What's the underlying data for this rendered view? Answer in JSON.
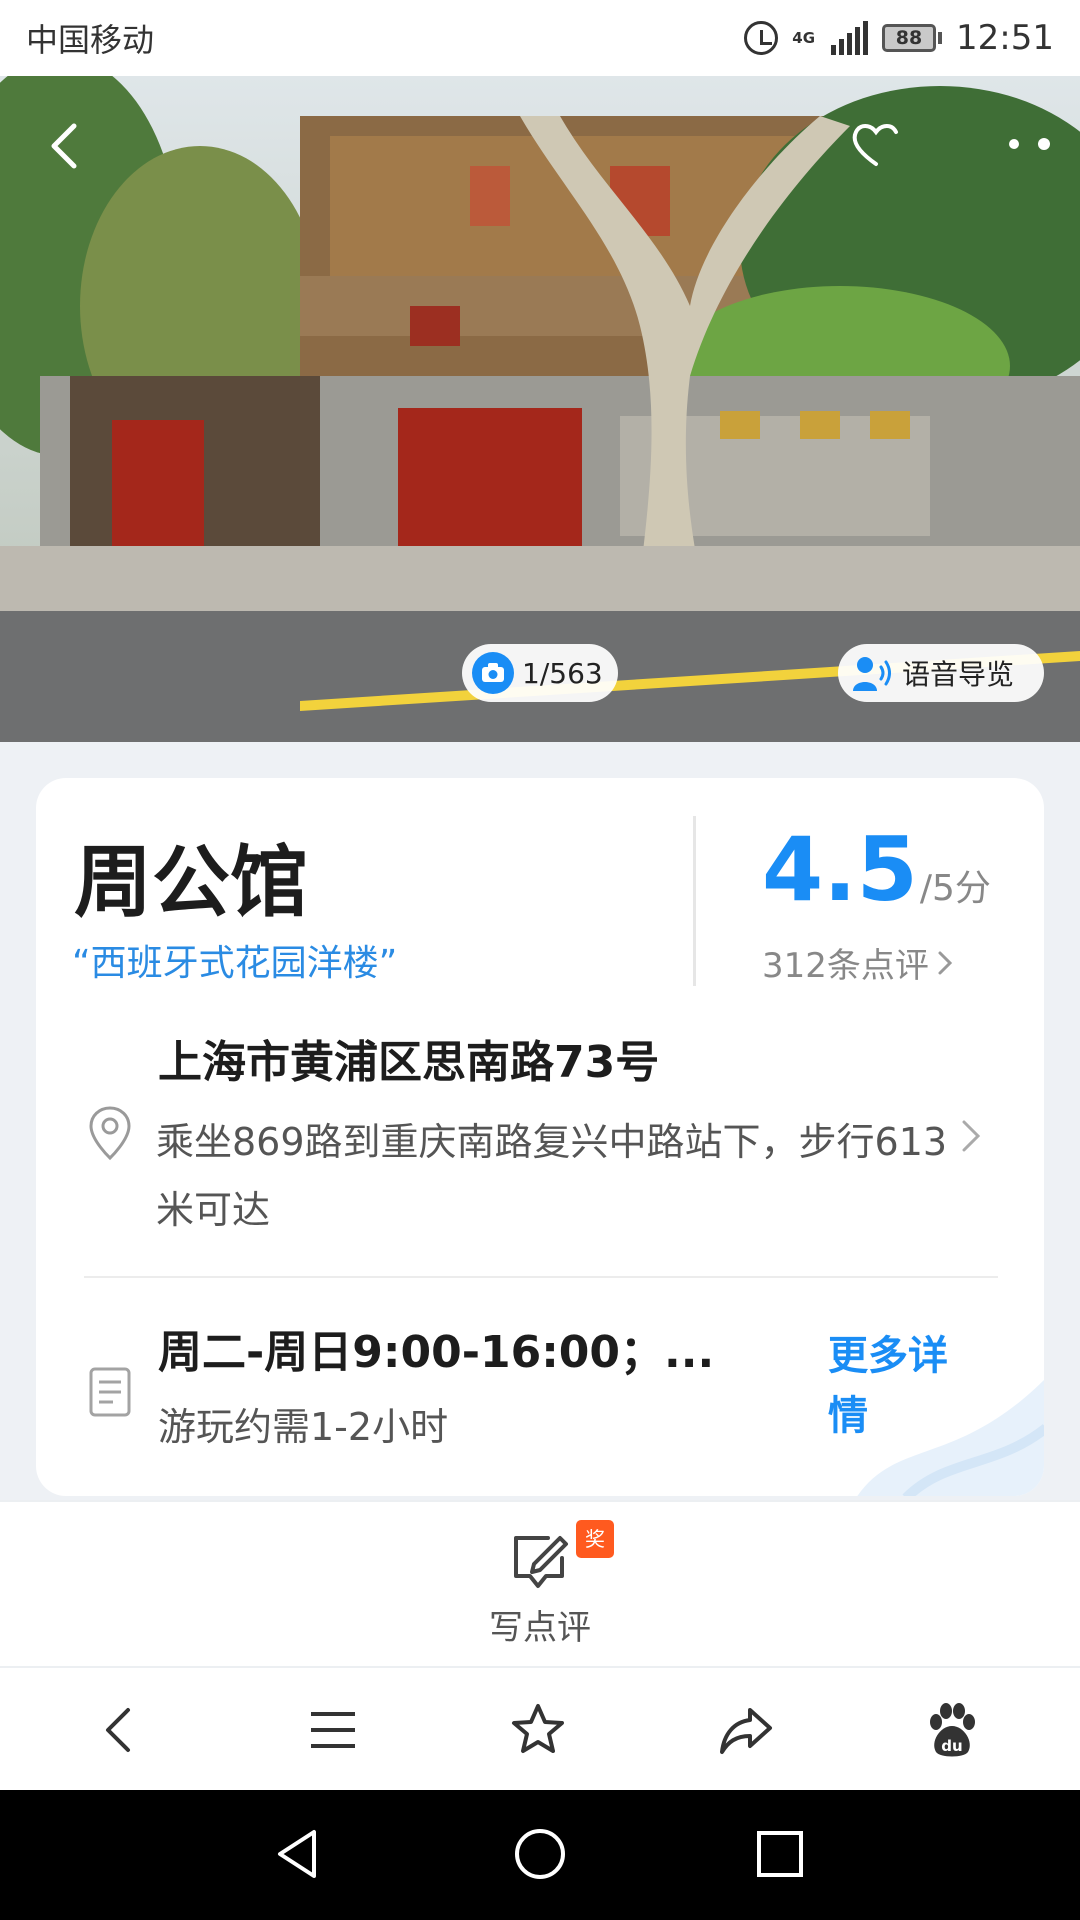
{
  "status_bar": {
    "carrier": "中国移动",
    "network": "4G",
    "battery": "88",
    "time": "12:51"
  },
  "hero": {
    "photo_counter": "1/563",
    "voice_guide_label": "语音导览"
  },
  "place": {
    "name": "周公馆",
    "tagline": "“西班牙式花园洋楼”",
    "rating": "4.5",
    "rating_max": "/5分",
    "review_count": "312条点评",
    "address": "上海市黄浦区思南路73号",
    "directions": "乘坐869路到重庆南路复兴中路站下，步行613米可达",
    "hours": "周二-周日9:00-16:00；...",
    "duration": "游玩约需1-2小时",
    "more_details": "更多详情"
  },
  "review_action": {
    "label": "写点评",
    "badge": "奖"
  },
  "toolbar": {
    "items": [
      "back-icon",
      "menu-icon",
      "star-icon",
      "share-icon",
      "baidu-paw-icon"
    ]
  },
  "colors": {
    "accent": "#1a8df5",
    "badge": "#ff5a1f",
    "text_primary": "#1d1d1d",
    "text_secondary": "#555555",
    "page_bg": "#eef1f5"
  }
}
